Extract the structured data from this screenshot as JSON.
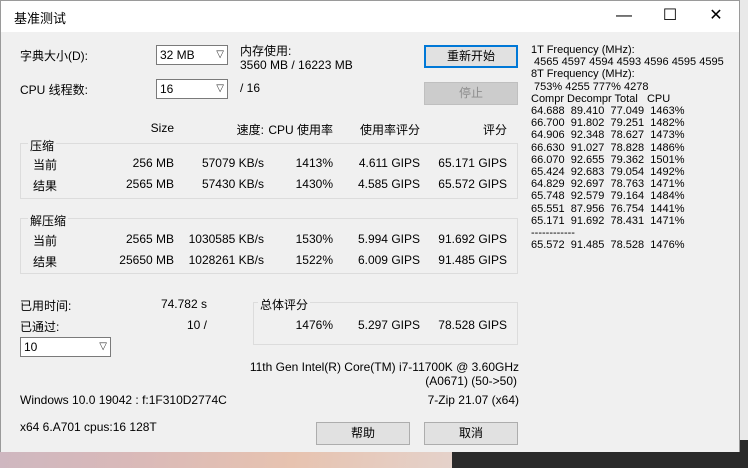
{
  "window": {
    "title": "基准测试",
    "minimize": "—",
    "maximize": "☐",
    "close": "✕"
  },
  "settings": {
    "dict_label": "字典大小(D):",
    "dict_value": "32 MB",
    "mem_label": "内存使用:",
    "mem_value": "3560 MB / 16223 MB",
    "threads_label": "CPU 线程数:",
    "threads_value": "16",
    "threads_total": "/ 16"
  },
  "buttons": {
    "restart": "重新开始",
    "stop": "停止",
    "help": "帮助",
    "cancel": "取消"
  },
  "table": {
    "headers": {
      "size": "Size",
      "speed": "速度:",
      "cpu": "CPU 使用率",
      "rating_usage": "使用率评分",
      "rating": "评分"
    },
    "compress": {
      "label": "压缩",
      "rows": [
        {
          "label": "当前",
          "size": "256 MB",
          "speed": "57079 KB/s",
          "cpu": "1413%",
          "usage": "4.611 GIPS",
          "rating": "65.171 GIPS"
        },
        {
          "label": "结果",
          "size": "2565 MB",
          "speed": "57430 KB/s",
          "cpu": "1430%",
          "usage": "4.585 GIPS",
          "rating": "65.572 GIPS"
        }
      ]
    },
    "decompress": {
      "label": "解压缩",
      "rows": [
        {
          "label": "当前",
          "size": "2565 MB",
          "speed": "1030585 KB/s",
          "cpu": "1530%",
          "usage": "5.994 GIPS",
          "rating": "91.692 GIPS"
        },
        {
          "label": "结果",
          "size": "25650 MB",
          "speed": "1028261 KB/s",
          "cpu": "1522%",
          "usage": "6.009 GIPS",
          "rating": "91.485 GIPS"
        }
      ]
    }
  },
  "status": {
    "elapsed_label": "已用时间:",
    "elapsed_value": "74.782 s",
    "passes_label": "已通过:",
    "passes_value": "10 /",
    "passes_select": "10"
  },
  "total": {
    "label": "总体评分",
    "cpu": "1476%",
    "usage": "5.297 GIPS",
    "rating": "78.528 GIPS"
  },
  "cpu_info": {
    "line1": "11th Gen Intel(R) Core(TM) i7-11700K @ 3.60GHz",
    "line2": "(A0671) (50->50)"
  },
  "os_info": "Windows 10.0 19042 : f:1F310D2774C",
  "version": "7-Zip 21.07 (x64)",
  "arch_info": "x64 6.A701 cpus:16 128T",
  "log_lines": [
    "1T Frequency (MHz):",
    " 4565 4597 4594 4593 4596 4595 4595",
    "8T Frequency (MHz):",
    " 753% 4255 777% 4278",
    "Compr Decompr Total   CPU",
    "64.688  89.410  77.049  1463%",
    "66.700  91.802  79.251  1482%",
    "64.906  92.348  78.627  1473%",
    "66.630  91.027  78.828  1486%",
    "66.070  92.655  79.362  1501%",
    "65.424  92.683  79.054  1492%",
    "64.829  92.697  78.763  1471%",
    "65.748  92.579  79.164  1484%",
    "65.551  87.956  76.754  1441%",
    "65.171  91.692  78.431  1471%",
    "------------",
    "65.572  91.485  78.528  1476%"
  ]
}
